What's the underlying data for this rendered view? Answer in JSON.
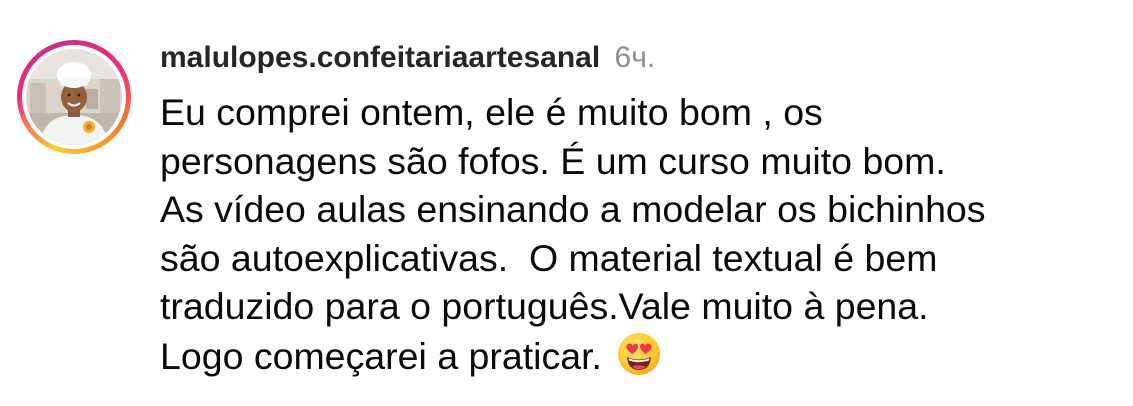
{
  "comment": {
    "username": "malulopes.confeitariaartesanal",
    "time": "6ч.",
    "lines": [
      "Eu comprei ontem, ele é muito bom , os",
      "personagens são fofos. É um curso muito bom.",
      "As vídeo aulas ensinando a modelar os bichinhos",
      "são autoexplicativas.  O material textual é bem",
      "traduzido para o português.Vale muito à pena.",
      "Logo começarei a praticar. "
    ],
    "emoji": "smiling-face-with-heart-eyes"
  },
  "avatar": {
    "ring_colors": [
      "#f9ce34",
      "#ee2a7b",
      "#c13584",
      "#f58529"
    ]
  },
  "colors": {
    "username": "#262626",
    "time": "#8e8e8e",
    "text": "#0a0a0a"
  }
}
